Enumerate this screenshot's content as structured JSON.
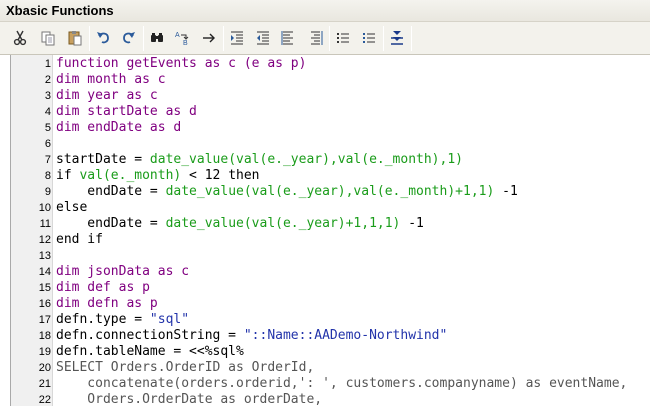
{
  "window": {
    "title": "Xbasic Functions"
  },
  "toolbar": {
    "buttons": [
      {
        "icon": "cut-icon",
        "tooltip": "Cut"
      },
      {
        "icon": "copy-icon",
        "tooltip": "Copy"
      },
      {
        "icon": "paste-icon",
        "tooltip": "Paste"
      },
      {
        "icon": "undo-icon",
        "tooltip": "Undo"
      },
      {
        "icon": "redo-icon",
        "tooltip": "Redo"
      },
      {
        "icon": "find-icon",
        "tooltip": "Find"
      },
      {
        "icon": "replace-icon",
        "tooltip": "Replace"
      },
      {
        "icon": "goto-icon",
        "tooltip": "Go to"
      },
      {
        "icon": "indent-icon",
        "tooltip": "Indent"
      },
      {
        "icon": "outdent-icon",
        "tooltip": "Outdent"
      },
      {
        "icon": "align-left-icon",
        "tooltip": "Align"
      },
      {
        "icon": "align-right-icon",
        "tooltip": "Align right"
      },
      {
        "icon": "comment-icon",
        "tooltip": "Comment"
      },
      {
        "icon": "uncomment-icon",
        "tooltip": "Uncomment"
      },
      {
        "icon": "collapse-icon",
        "tooltip": "Collapse"
      }
    ]
  },
  "colors": {
    "keyword": "#800080",
    "function": "#1a9c1a",
    "string": "#2233aa",
    "sql": "#555555"
  },
  "editor": {
    "lines": [
      {
        "n": "1",
        "parts": [
          [
            "kw",
            "function getEvents as c (e as p)"
          ]
        ]
      },
      {
        "n": "2",
        "parts": [
          [
            "kw",
            "dim month as c"
          ]
        ]
      },
      {
        "n": "3",
        "parts": [
          [
            "kw",
            "dim year as c"
          ]
        ]
      },
      {
        "n": "4",
        "parts": [
          [
            "kw",
            "dim startDate as d"
          ]
        ]
      },
      {
        "n": "5",
        "parts": [
          [
            "kw",
            "dim endDate as d"
          ]
        ]
      },
      {
        "n": "6",
        "parts": []
      },
      {
        "n": "7",
        "parts": [
          [
            "plain",
            "startDate = "
          ],
          [
            "fn",
            "date_value(val(e._year),val(e._month),1)"
          ]
        ]
      },
      {
        "n": "8",
        "parts": [
          [
            "plain",
            "if "
          ],
          [
            "fn",
            "val(e._month)"
          ],
          [
            "plain",
            " < 12 then"
          ]
        ]
      },
      {
        "n": "9",
        "parts": [
          [
            "plain",
            "    endDate = "
          ],
          [
            "fn",
            "date_value(val(e._year),val(e._month)+1,1)"
          ],
          [
            "plain",
            " -1"
          ]
        ]
      },
      {
        "n": "10",
        "parts": [
          [
            "plain",
            "else"
          ]
        ]
      },
      {
        "n": "11",
        "parts": [
          [
            "plain",
            "    endDate = "
          ],
          [
            "fn",
            "date_value(val(e._year)+1,1,1)"
          ],
          [
            "plain",
            " -1"
          ]
        ]
      },
      {
        "n": "12",
        "parts": [
          [
            "plain",
            "end if"
          ]
        ]
      },
      {
        "n": "13",
        "parts": []
      },
      {
        "n": "14",
        "parts": [
          [
            "kw",
            "dim jsonData as c"
          ]
        ]
      },
      {
        "n": "15",
        "parts": [
          [
            "kw",
            "dim def as p"
          ]
        ]
      },
      {
        "n": "16",
        "parts": [
          [
            "kw",
            "dim defn as p"
          ]
        ]
      },
      {
        "n": "17",
        "parts": [
          [
            "plain",
            "defn.type = "
          ],
          [
            "str",
            "\"sql\""
          ]
        ]
      },
      {
        "n": "18",
        "parts": [
          [
            "plain",
            "defn.connectionString = "
          ],
          [
            "str",
            "\"::Name::AADemo-Northwind\""
          ]
        ]
      },
      {
        "n": "19",
        "parts": [
          [
            "plain",
            "defn.tableName = <<%sql%"
          ]
        ]
      },
      {
        "n": "20",
        "parts": [
          [
            "sql",
            "SELECT Orders.OrderID as OrderId,"
          ]
        ]
      },
      {
        "n": "21",
        "parts": [
          [
            "sql",
            "    concatenate(orders.orderid,': ', customers.companyname) as eventName,"
          ]
        ]
      },
      {
        "n": "22",
        "parts": [
          [
            "sql",
            "    Orders.OrderDate as orderDate,"
          ]
        ]
      }
    ]
  }
}
